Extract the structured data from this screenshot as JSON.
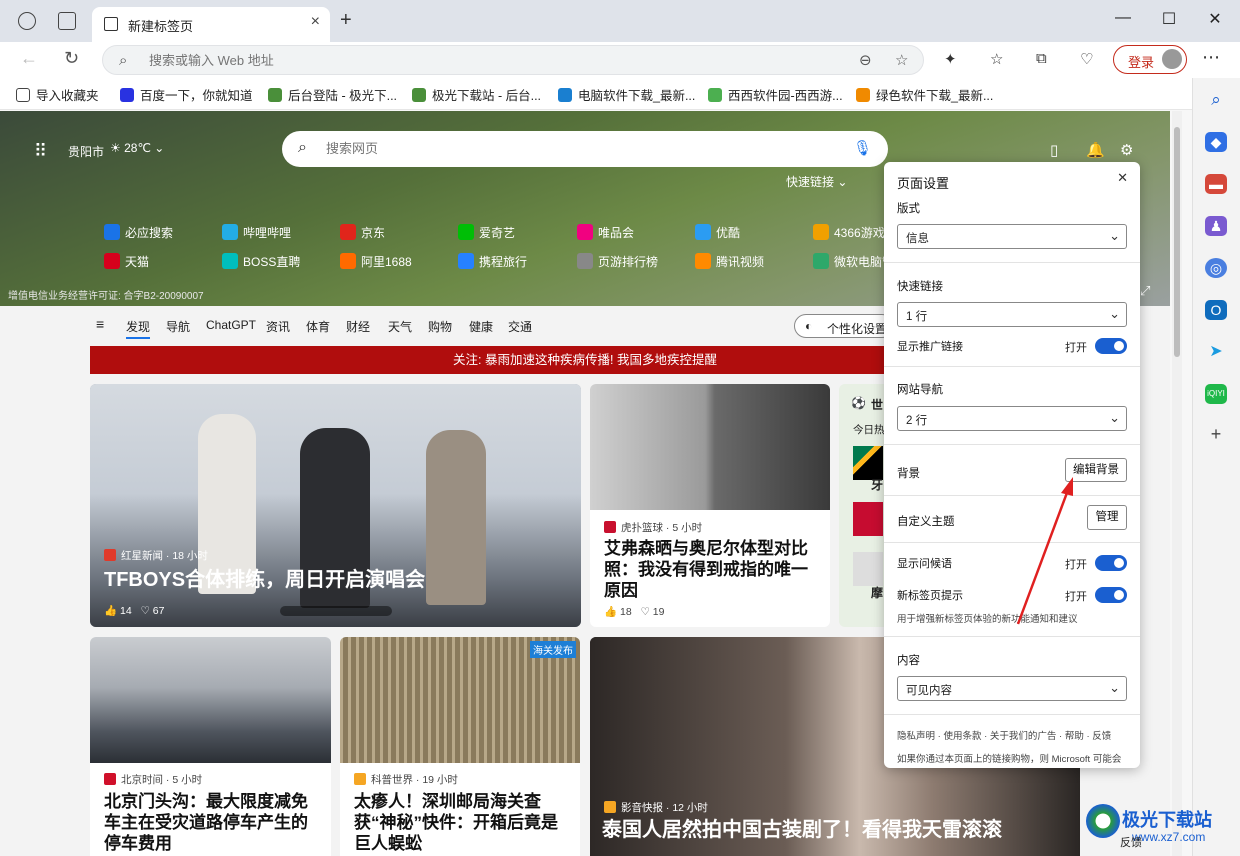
{
  "browser": {
    "tab_title": "新建标签页",
    "address_placeholder": "搜索或输入 Web 地址",
    "login_label": "登录"
  },
  "favorites": [
    {
      "label": "导入收藏夹",
      "color": "#444"
    },
    {
      "label": "百度一下，你就知道",
      "color": "#2932e1"
    },
    {
      "label": "后台登陆 - 极光下...",
      "color": "#4a8f3a"
    },
    {
      "label": "极光下载站 - 后台...",
      "color": "#4a8f3a"
    },
    {
      "label": "电脑软件下载_最新...",
      "color": "#1a7fd0"
    },
    {
      "label": "西西软件园-西西游...",
      "color": "#4caf50"
    },
    {
      "label": "绿色软件下载_最新...",
      "color": "#f08a00"
    }
  ],
  "hero": {
    "city": "贵阳市",
    "temperature": "28℃",
    "search_placeholder": "搜索网页",
    "quick_links_label": "快速链接",
    "license": "增值电信业务经营许可证: 合字B2-20090007",
    "links_row1": [
      "必应搜索",
      "哔哩哔哩",
      "京东",
      "爱奇艺",
      "唯品会",
      "优酷",
      "4366游戏"
    ],
    "links_row2": [
      "天猫",
      "BOSS直聘",
      "阿里1688",
      "携程旅行",
      "页游排行榜",
      "腾讯视频",
      "微软电脑管"
    ]
  },
  "nav_tabs": [
    "发现",
    "导航",
    "ChatGPT",
    "资讯",
    "体育",
    "财经",
    "天气",
    "购物",
    "健康",
    "交通"
  ],
  "personalize_label": "个性化设置",
  "alert": "关注: 暴雨加速这种疾病传播! 我国多地疾控提醒",
  "cards": {
    "main": {
      "source": "红星新闻 · 18 小时",
      "title": "TFBOYS合体排练，周日开启演唱会",
      "likes": "14",
      "comments": "67"
    },
    "hupu": {
      "source": "虎扑篮球 · 5 小时",
      "title": "艾弗森晒与奥尼尔体型对比照：我没有得到戒指的唯一原因",
      "likes": "18",
      "comments": "19"
    },
    "world": {
      "prefix": "世",
      "sub": "今日热",
      "a": "牙",
      "b": "摩"
    },
    "bj": {
      "source": "北京时间 · 5 小时",
      "title": "北京门头沟：最大限度减免车主在受灾道路停车产生的停车费用"
    },
    "sci": {
      "source": "科普世界 · 19 小时",
      "title": "太瘆人！深圳邮局海关查获“神秘”快件：开箱后竟是巨人蜈蚣",
      "tag": "海关发布"
    },
    "movie": {
      "source": "影音快报 · 12 小时",
      "title": "泰国人居然拍中国古装剧了！看得我天雷滚滚"
    }
  },
  "settings": {
    "title": "页面设置",
    "layout_label": "版式",
    "layout_value": "信息",
    "quicklinks_label": "快速链接",
    "quicklinks_value": "1 行",
    "show_promo_label": "显示推广链接",
    "on_label": "打开",
    "site_nav_label": "网站导航",
    "site_nav_value": "2 行",
    "background_label": "背景",
    "edit_bg_label": "编辑背景",
    "custom_theme_label": "自定义主题",
    "manage_label": "管理",
    "greeting_label": "显示问候语",
    "newtab_tips_label": "新标签页提示",
    "tips_desc": "用于增强新标签页体验的新功能通知和建议",
    "content_label": "内容",
    "content_value": "可见内容",
    "footer_links": "隐私声明 · 使用条款 · 关于我们的广告 · 帮助 · 反馈",
    "footer_note": "如果你通过本页面上的链接购物，则 Microsoft 可能会"
  },
  "watermark": {
    "name": "极光下载站",
    "url": "www.xz7.com"
  },
  "feedback_label": "反馈"
}
